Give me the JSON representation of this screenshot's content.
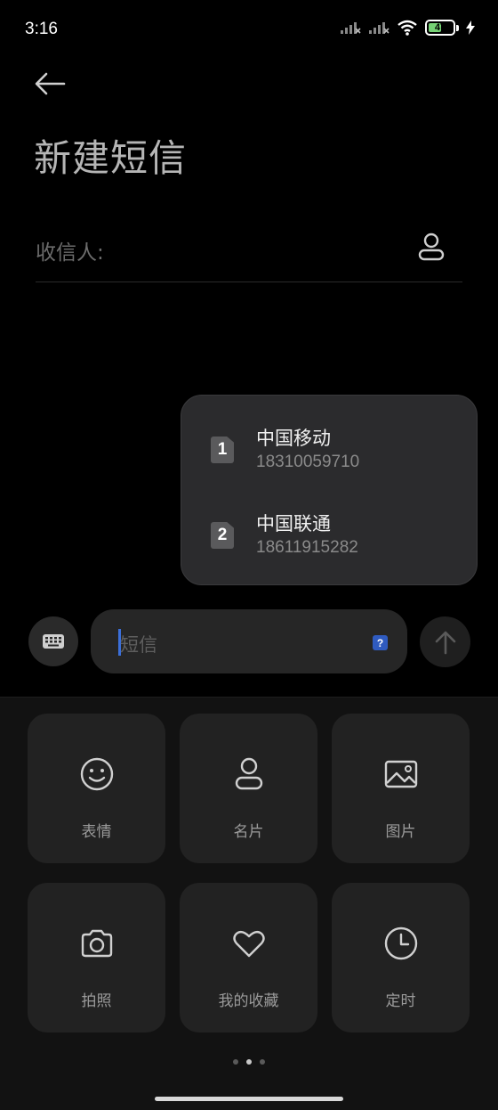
{
  "status": {
    "time": "3:16",
    "battery": "47"
  },
  "header": {
    "title": "新建短信"
  },
  "recipient": {
    "label": "收信人:"
  },
  "sim_options": [
    {
      "slot": "1",
      "name": "中国移动",
      "number": "18310059710"
    },
    {
      "slot": "2",
      "name": "中国联通",
      "number": "18611915282"
    }
  ],
  "compose": {
    "placeholder": "短信",
    "help": "?"
  },
  "attachments": [
    {
      "label": "表情",
      "icon": "emoji-icon"
    },
    {
      "label": "名片",
      "icon": "contact-card-icon"
    },
    {
      "label": "图片",
      "icon": "image-icon"
    },
    {
      "label": "拍照",
      "icon": "camera-icon"
    },
    {
      "label": "我的收藏",
      "icon": "heart-icon"
    },
    {
      "label": "定时",
      "icon": "clock-icon"
    }
  ],
  "pager": {
    "count": 3,
    "active": 2
  },
  "colors": {
    "accent": "#3b6fd9",
    "background": "#000000",
    "panel": "#121212",
    "tile": "#222222"
  }
}
